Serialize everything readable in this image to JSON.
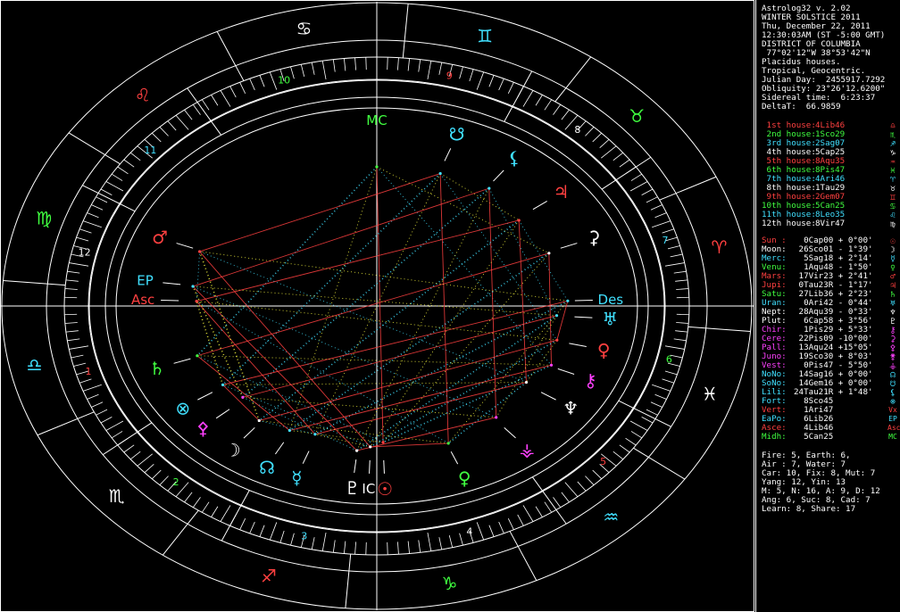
{
  "header": [
    "Astrolog32 v. 2.02",
    "WINTER SOLSTICE 2011",
    "Thu, December 22, 2011",
    "12:30:03AM (ST -5:00 GMT)",
    "DISTRICT OF COLUMBIA",
    " 77°02'12\"W 38°53'42\"N",
    "Placidus houses.",
    "Tropical, Geocentric.",
    "Julian Day:  2455917.7292",
    "Obliquity: 23°26'12.6200\"",
    "Sidereal time:  6:23:37",
    "DeltaT:  66.9859"
  ],
  "houses": [
    {
      "label": "1st house:",
      "pos": "4Lib46",
      "glyph": "♎",
      "color": "#ff4040"
    },
    {
      "label": "2nd house:",
      "pos": "1Sco29",
      "glyph": "♏",
      "color": "#40ff40"
    },
    {
      "label": "3rd house:",
      "pos": "2Sag07",
      "glyph": "♐",
      "color": "#40e0ff"
    },
    {
      "label": "4th house:",
      "pos": "5Cap25",
      "glyph": "♑",
      "color": "#ffffff"
    },
    {
      "label": "5th house:",
      "pos": "8Aqu35",
      "glyph": "♒",
      "color": "#ff4040"
    },
    {
      "label": "6th house:",
      "pos": "8Pis47",
      "glyph": "♓",
      "color": "#40ff40"
    },
    {
      "label": "7th house:",
      "pos": "4Ari46",
      "glyph": "♈",
      "color": "#40e0ff"
    },
    {
      "label": "8th house:",
      "pos": "1Tau29",
      "glyph": "♉",
      "color": "#ffffff"
    },
    {
      "label": "9th house:",
      "pos": "2Gem07",
      "glyph": "♊",
      "color": "#ff4040"
    },
    {
      "label": "10th house:",
      "pos": "5Can25",
      "glyph": "♋",
      "color": "#40ff40"
    },
    {
      "label": "11th house:",
      "pos": "8Leo35",
      "glyph": "♌",
      "color": "#40e0ff"
    },
    {
      "label": "12th house:",
      "pos": "8Vir47",
      "glyph": "♍",
      "color": "#ffffff"
    }
  ],
  "planets": [
    {
      "name": "Sun :",
      "pos": "0Cap00",
      "lat": "+ 0°00'",
      "glyph": "☉",
      "color": "#ff4040"
    },
    {
      "name": "Moon:",
      "pos": "26Sco01",
      "lat": "- 1°39'",
      "glyph": "☽",
      "color": "#ffffff"
    },
    {
      "name": "Merc:",
      "pos": "5Sag18",
      "lat": "+ 2°14'",
      "glyph": "☿",
      "color": "#40e0ff"
    },
    {
      "name": "Venu:",
      "pos": "1Aqu48",
      "lat": "- 1°50'",
      "glyph": "♀",
      "color": "#40ff40"
    },
    {
      "name": "Mars:",
      "pos": "17Vir23",
      "lat": "+ 2°41'",
      "glyph": "♂",
      "color": "#ff4040"
    },
    {
      "name": "Jupi:",
      "pos": "0Tau23R",
      "lat": "- 1°17'",
      "glyph": "♃",
      "color": "#ff4040"
    },
    {
      "name": "Satu:",
      "pos": "27Lib36",
      "lat": "+ 2°23'",
      "glyph": "♄",
      "color": "#40ff40"
    },
    {
      "name": "Uran:",
      "pos": "0Ari42",
      "lat": "- 0°44'",
      "glyph": "♅",
      "color": "#40e0ff"
    },
    {
      "name": "Nept:",
      "pos": "28Aqu39",
      "lat": "- 0°33'",
      "glyph": "♆",
      "color": "#ffffff"
    },
    {
      "name": "Plut:",
      "pos": "6Cap58",
      "lat": "+ 3°56'",
      "glyph": "♇",
      "color": "#ffffff"
    },
    {
      "name": "Chir:",
      "pos": "1Pis29",
      "lat": "+ 5°33'",
      "glyph": "⚷",
      "color": "#ff40ff"
    },
    {
      "name": "Cere:",
      "pos": "22Pis09",
      "lat": "-10°00'",
      "glyph": "⚳",
      "color": "#ff40ff"
    },
    {
      "name": "Pall:",
      "pos": "13Aqu24",
      "lat": "+15°05'",
      "glyph": "⚴",
      "color": "#ff40ff"
    },
    {
      "name": "Juno:",
      "pos": "19Sco30",
      "lat": "+ 8°03'",
      "glyph": "⚵",
      "color": "#ff40ff"
    },
    {
      "name": "Vest:",
      "pos": "0Pis47",
      "lat": "- 5°50'",
      "glyph": "⚶",
      "color": "#ff40ff"
    },
    {
      "name": "NoNo:",
      "pos": "14Sag16",
      "lat": "+ 0°00'",
      "glyph": "☊",
      "color": "#40e0ff"
    },
    {
      "name": "SoNo:",
      "pos": "14Gem16",
      "lat": "+ 0°00'",
      "glyph": "☋",
      "color": "#40e0ff"
    },
    {
      "name": "Lili:",
      "pos": "24Tau21R",
      "lat": "+ 1°48'",
      "glyph": "⚸",
      "color": "#40e0ff"
    },
    {
      "name": "Fort:",
      "pos": "8Sco45",
      "lat": "",
      "glyph": "⊗",
      "color": "#40e0ff"
    },
    {
      "name": "Vert:",
      "pos": "1Ari47",
      "lat": "",
      "glyph": "Vx",
      "color": "#ff4040"
    },
    {
      "name": "EaPo:",
      "pos": "6Lib26",
      "lat": "",
      "glyph": "EP",
      "color": "#40e0ff"
    },
    {
      "name": "Asce:",
      "pos": "4Lib46",
      "lat": "",
      "glyph": "Asc",
      "color": "#ff4040"
    },
    {
      "name": "Midh:",
      "pos": "5Can25",
      "lat": "",
      "glyph": "MC",
      "color": "#40ff40"
    }
  ],
  "summary": [
    "Fire: 5, Earth: 6,",
    "Air : 7, Water: 7",
    "Car: 10, Fix: 8, Mut: 7",
    "Yang: 12, Yin: 13",
    "M: 5, N: 16, A: 9, D: 12",
    "Ang: 6, Suc: 8, Cad: 7",
    "Learn: 8, Share: 17"
  ],
  "wheel": {
    "houseNumbers": [
      "1",
      "2",
      "3",
      "4",
      "5",
      "6",
      "7",
      "8",
      "9",
      "10",
      "11",
      "12"
    ],
    "signs": [
      {
        "glyph": "♎",
        "color": "#40e0ff"
      },
      {
        "glyph": "♏",
        "color": "#ffffff"
      },
      {
        "glyph": "♐",
        "color": "#ff4040"
      },
      {
        "glyph": "♑",
        "color": "#40ff40"
      },
      {
        "glyph": "♒",
        "color": "#40e0ff"
      },
      {
        "glyph": "♓",
        "color": "#ffffff"
      },
      {
        "glyph": "♈",
        "color": "#ff4040"
      },
      {
        "glyph": "♉",
        "color": "#40ff40"
      },
      {
        "glyph": "♊",
        "color": "#40e0ff"
      },
      {
        "glyph": "♋",
        "color": "#ffffff"
      },
      {
        "glyph": "♌",
        "color": "#ff4040"
      },
      {
        "glyph": "♍",
        "color": "#40ff40"
      }
    ],
    "points": [
      {
        "glyph": "MC",
        "color": "#40ff40"
      },
      {
        "glyph": "☋",
        "color": "#40e0ff"
      },
      {
        "glyph": "⚸",
        "color": "#40e0ff"
      },
      {
        "glyph": "♃",
        "color": "#ff4040"
      },
      {
        "glyph": "⚳",
        "color": "#ffffff"
      },
      {
        "glyph": "Des",
        "color": "#40e0ff"
      },
      {
        "glyph": "♅",
        "color": "#40e0ff"
      },
      {
        "glyph": "♀",
        "color": "#ff4040"
      },
      {
        "glyph": "⚷",
        "color": "#ff40ff"
      },
      {
        "glyph": "♆",
        "color": "#ffffff"
      },
      {
        "glyph": "⚶",
        "color": "#ff40ff"
      },
      {
        "glyph": "♀",
        "color": "#40ff40"
      },
      {
        "glyph": "☉",
        "color": "#ff4040"
      },
      {
        "glyph": "IC",
        "color": "#ffffff"
      },
      {
        "glyph": "♇",
        "color": "#ffffff"
      },
      {
        "glyph": "☿",
        "color": "#40e0ff"
      },
      {
        "glyph": "☊",
        "color": "#40e0ff"
      },
      {
        "glyph": "☽",
        "color": "#ffffff"
      },
      {
        "glyph": "⚴",
        "color": "#ff40ff"
      },
      {
        "glyph": "⊗",
        "color": "#40e0ff"
      },
      {
        "glyph": "♄",
        "color": "#40ff40"
      },
      {
        "glyph": "Asc",
        "color": "#ff4040"
      },
      {
        "glyph": "EP",
        "color": "#40e0ff"
      },
      {
        "glyph": "♂",
        "color": "#ff4040"
      }
    ]
  }
}
